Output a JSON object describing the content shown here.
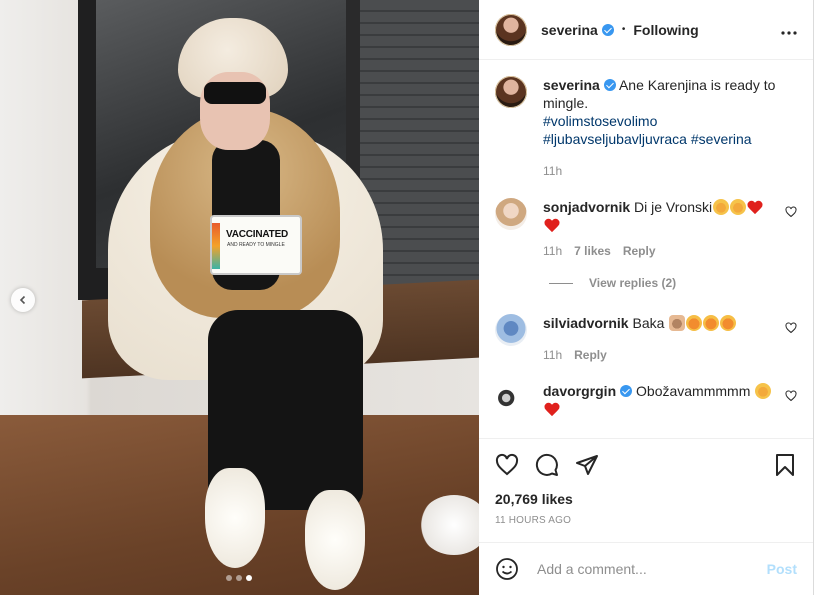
{
  "post": {
    "author": "severina",
    "follow_status": "Following",
    "separator": "•"
  },
  "caption": {
    "author": "severina",
    "text_line1": "Ane Karenjina is ready to mingle.",
    "hashtags": [
      "#volimstosevolimo",
      "#ljubavseljubavljuvraca",
      "#severina"
    ],
    "time": "11h"
  },
  "comments": [
    {
      "author": "sonjadvornik",
      "text": "Di je Vronski",
      "emojis": [
        "laugh",
        "laugh",
        "heart",
        "heart"
      ],
      "time": "11h",
      "likes": "7 likes",
      "reply_label": "Reply",
      "view_replies": "View replies (2)"
    },
    {
      "author": "silviadvornik",
      "text": "Baka",
      "emojis": [
        "pray",
        "love",
        "love",
        "love"
      ],
      "time": "11h",
      "reply_label": "Reply"
    },
    {
      "author": "davorgrgin",
      "verified": true,
      "text": "Obožavammmmm",
      "emojis": [
        "laugh",
        "heart"
      ]
    }
  ],
  "photo": {
    "bag_text_main": "VACCINATED",
    "bag_text_sub": "AND READY TO MINGLE",
    "carousel_count": 3,
    "carousel_active": 3
  },
  "actions": {
    "likes": "20,769 likes",
    "timestamp": "11 HOURS AGO"
  },
  "composer": {
    "placeholder": "Add a comment...",
    "post_label": "Post"
  },
  "icons": [
    "chevron-left-icon",
    "more-icon",
    "heart-icon",
    "comment-icon",
    "share-icon",
    "bookmark-icon",
    "emoji-icon",
    "verified-icon"
  ],
  "colors": {
    "verified": "#3897f0",
    "hashtag": "#00376b",
    "muted": "#8e8e8e",
    "post_button_disabled": "#b2dffc"
  }
}
